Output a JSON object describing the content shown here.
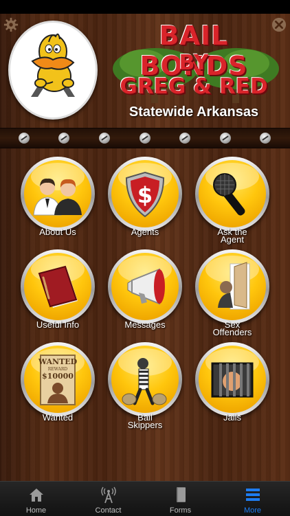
{
  "header": {
    "title_line1": "BAIL BONDS",
    "title_line2": "BY",
    "title_line3": "GREG & RED",
    "subtitle": "Statewide Arkansas"
  },
  "menu": {
    "items": [
      {
        "label": "About Us",
        "icon": "people-icon"
      },
      {
        "label": "Agents",
        "icon": "dollar-shield-icon"
      },
      {
        "label": "Ask the Agent",
        "icon": "microphone-icon"
      },
      {
        "label": "Useful Info",
        "icon": "book-icon"
      },
      {
        "label": "Messages",
        "icon": "megaphone-icon"
      },
      {
        "label": "Sex Offenders",
        "icon": "door-peek-icon"
      },
      {
        "label": "Wanted",
        "icon": "wanted-poster-icon"
      },
      {
        "label": "Bail Skippers",
        "icon": "robber-icon"
      },
      {
        "label": "Jails",
        "icon": "jail-bars-icon"
      }
    ],
    "labels_display": {
      "ask_l1": "Ask the",
      "ask_l2": "Agent",
      "sex_l1": "Sex",
      "sex_l2": "Offenders",
      "bail_l1": "Bail",
      "bail_l2": "Skippers"
    },
    "wanted_poster": {
      "title": "WANTED",
      "reward": "REWARD",
      "amount": "$10000"
    }
  },
  "tabbar": {
    "tabs": [
      {
        "label": "Home",
        "icon": "house-icon"
      },
      {
        "label": "Contact",
        "icon": "antenna-icon"
      },
      {
        "label": "Forms",
        "icon": "book-icon"
      },
      {
        "label": "More",
        "icon": "hamburger-icon"
      }
    ],
    "active": "More",
    "active_color": "#1e7cf0"
  },
  "colors": {
    "title_red": "#d9242a",
    "button_yellow": "#ffc60d"
  }
}
